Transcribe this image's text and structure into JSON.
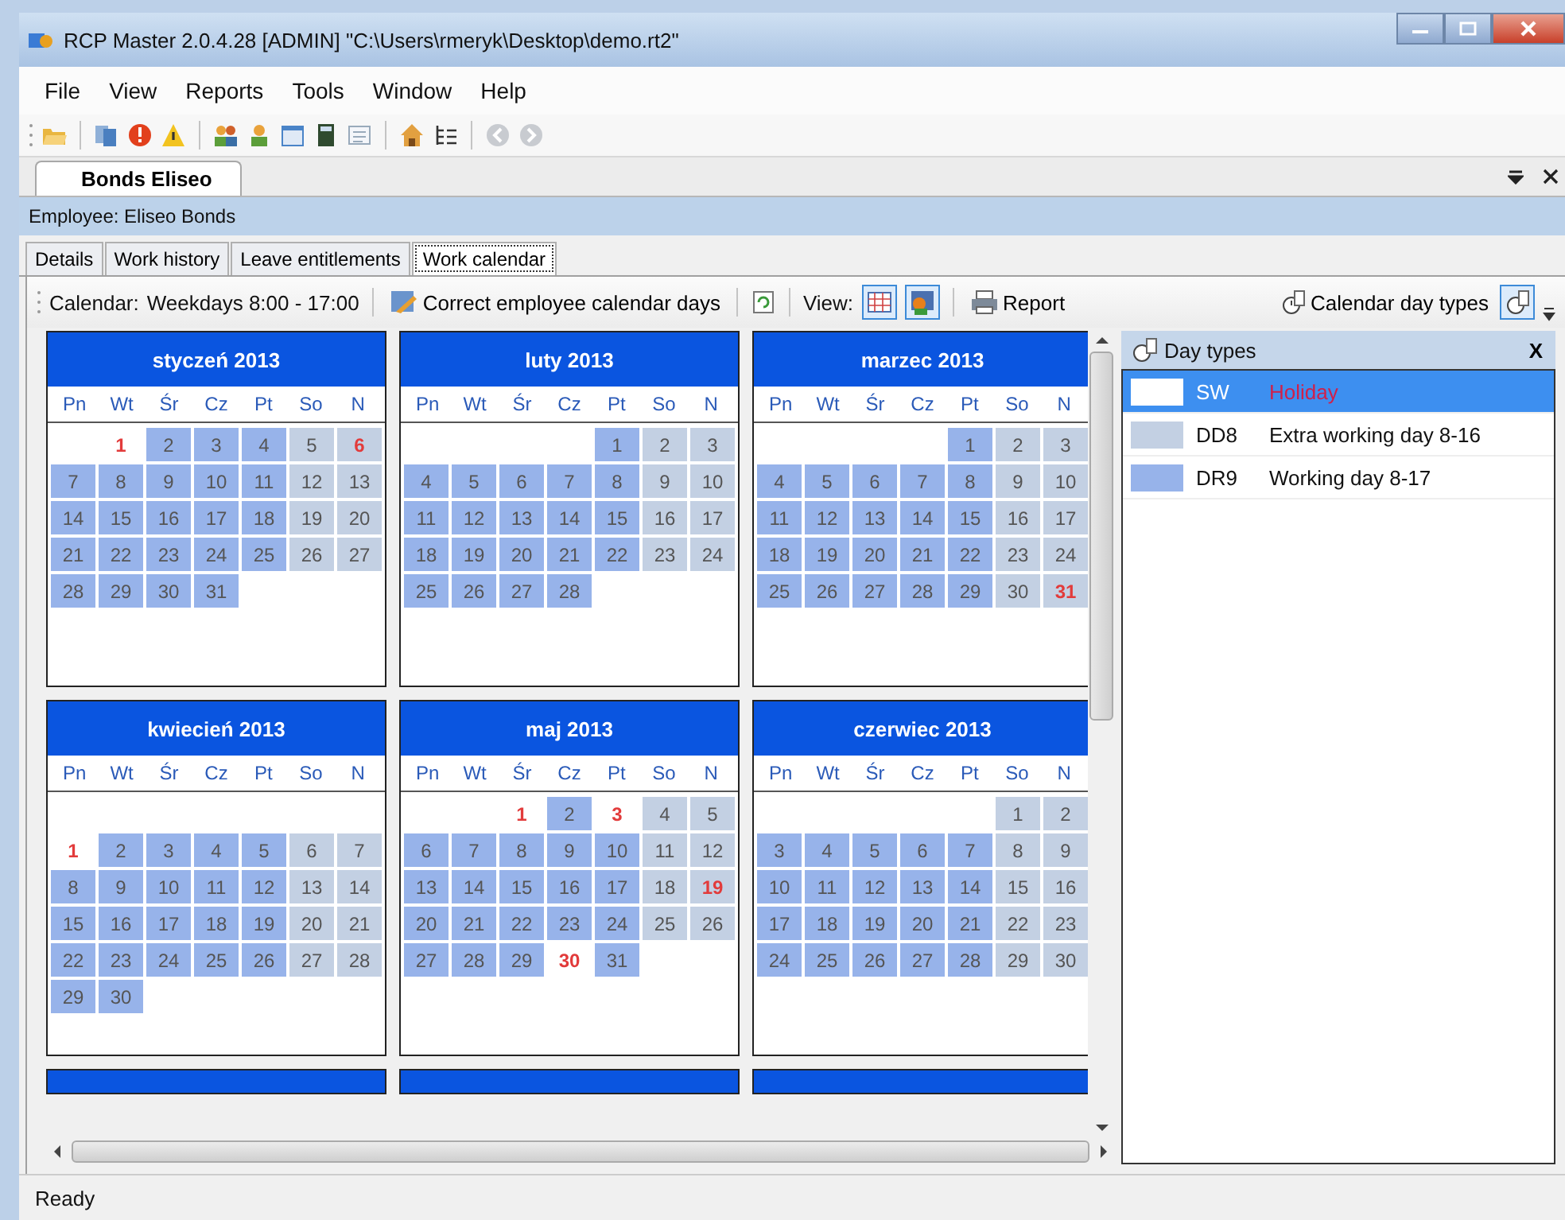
{
  "window": {
    "title": "RCP Master 2.0.4.28  [ADMIN] \"C:\\Users\\rmeryk\\Desktop\\demo.rt2\""
  },
  "menu": [
    "File",
    "View",
    "Reports",
    "Tools",
    "Window",
    "Help"
  ],
  "document_tabs": [
    {
      "label": "Bonds Eliseo",
      "selected": true
    }
  ],
  "employee_bar": "Employee: Eliseo Bonds",
  "tabs": [
    {
      "label": "Details",
      "selected": false
    },
    {
      "label": "Work history",
      "selected": false
    },
    {
      "label": "Leave entitlements",
      "selected": false
    },
    {
      "label": "Work calendar",
      "selected": true
    }
  ],
  "calendar_toolbar": {
    "calendar_label": "Calendar:",
    "calendar_value": "Weekdays 8:00 - 17:00",
    "correct_button": "Correct employee calendar days",
    "view_label": "View:",
    "report_button": "Report",
    "day_types_button": "Calendar day types"
  },
  "months": [
    {
      "title": "styczeń 2013",
      "weekdays": [
        "Pn",
        "Wt",
        "Śr",
        "Cz",
        "Pt",
        "So",
        "N"
      ],
      "weeks": [
        [
          {
            "kind": "blank"
          },
          {
            "kind": "day",
            "d": "1",
            "color": "#ffffff",
            "holiday": true
          },
          {
            "kind": "day",
            "d": "2",
            "color": "#97b3ea",
            "holiday": false
          },
          {
            "kind": "day",
            "d": "3",
            "color": "#97b3ea",
            "holiday": false
          },
          {
            "kind": "day",
            "d": "4",
            "color": "#97b3ea",
            "holiday": false
          },
          {
            "kind": "day",
            "d": "5",
            "color": "#c3d0e3",
            "holiday": false
          },
          {
            "kind": "day",
            "d": "6",
            "color": "#c3d0e3",
            "holiday": true
          }
        ],
        [
          {
            "kind": "day",
            "d": "7",
            "color": "#97b3ea",
            "holiday": false
          },
          {
            "kind": "day",
            "d": "8",
            "color": "#97b3ea",
            "holiday": false
          },
          {
            "kind": "day",
            "d": "9",
            "color": "#97b3ea",
            "holiday": false
          },
          {
            "kind": "day",
            "d": "10",
            "color": "#97b3ea",
            "holiday": false
          },
          {
            "kind": "day",
            "d": "11",
            "color": "#97b3ea",
            "holiday": false
          },
          {
            "kind": "day",
            "d": "12",
            "color": "#c3d0e3",
            "holiday": false
          },
          {
            "kind": "day",
            "d": "13",
            "color": "#c3d0e3",
            "holiday": false
          }
        ],
        [
          {
            "kind": "day",
            "d": "14",
            "color": "#97b3ea",
            "holiday": false
          },
          {
            "kind": "day",
            "d": "15",
            "color": "#97b3ea",
            "holiday": false
          },
          {
            "kind": "day",
            "d": "16",
            "color": "#97b3ea",
            "holiday": false
          },
          {
            "kind": "day",
            "d": "17",
            "color": "#97b3ea",
            "holiday": false
          },
          {
            "kind": "day",
            "d": "18",
            "color": "#97b3ea",
            "holiday": false
          },
          {
            "kind": "day",
            "d": "19",
            "color": "#c3d0e3",
            "holiday": false
          },
          {
            "kind": "day",
            "d": "20",
            "color": "#c3d0e3",
            "holiday": false
          }
        ],
        [
          {
            "kind": "day",
            "d": "21",
            "color": "#97b3ea",
            "holiday": false
          },
          {
            "kind": "day",
            "d": "22",
            "color": "#97b3ea",
            "holiday": false
          },
          {
            "kind": "day",
            "d": "23",
            "color": "#97b3ea",
            "holiday": false
          },
          {
            "kind": "day",
            "d": "24",
            "color": "#97b3ea",
            "holiday": false
          },
          {
            "kind": "day",
            "d": "25",
            "color": "#97b3ea",
            "holiday": false
          },
          {
            "kind": "day",
            "d": "26",
            "color": "#c3d0e3",
            "holiday": false
          },
          {
            "kind": "day",
            "d": "27",
            "color": "#c3d0e3",
            "holiday": false
          }
        ],
        [
          {
            "kind": "day",
            "d": "28",
            "color": "#97b3ea",
            "holiday": false
          },
          {
            "kind": "day",
            "d": "29",
            "color": "#97b3ea",
            "holiday": false
          },
          {
            "kind": "day",
            "d": "30",
            "color": "#97b3ea",
            "holiday": false
          },
          {
            "kind": "day",
            "d": "31",
            "color": "#97b3ea",
            "holiday": false
          },
          {
            "kind": "blank"
          },
          {
            "kind": "blank"
          },
          {
            "kind": "blank"
          }
        ]
      ]
    },
    {
      "title": "luty 2013",
      "weekdays": [
        "Pn",
        "Wt",
        "Śr",
        "Cz",
        "Pt",
        "So",
        "N"
      ],
      "weeks": [
        [
          {
            "kind": "blank"
          },
          {
            "kind": "blank"
          },
          {
            "kind": "blank"
          },
          {
            "kind": "blank"
          },
          {
            "kind": "day",
            "d": "1",
            "color": "#97b3ea",
            "holiday": false
          },
          {
            "kind": "day",
            "d": "2",
            "color": "#c3d0e3",
            "holiday": false
          },
          {
            "kind": "day",
            "d": "3",
            "color": "#c3d0e3",
            "holiday": false
          }
        ],
        [
          {
            "kind": "day",
            "d": "4",
            "color": "#97b3ea",
            "holiday": false
          },
          {
            "kind": "day",
            "d": "5",
            "color": "#97b3ea",
            "holiday": false
          },
          {
            "kind": "day",
            "d": "6",
            "color": "#97b3ea",
            "holiday": false
          },
          {
            "kind": "day",
            "d": "7",
            "color": "#97b3ea",
            "holiday": false
          },
          {
            "kind": "day",
            "d": "8",
            "color": "#97b3ea",
            "holiday": false
          },
          {
            "kind": "day",
            "d": "9",
            "color": "#c3d0e3",
            "holiday": false
          },
          {
            "kind": "day",
            "d": "10",
            "color": "#c3d0e3",
            "holiday": false
          }
        ],
        [
          {
            "kind": "day",
            "d": "11",
            "color": "#97b3ea",
            "holiday": false
          },
          {
            "kind": "day",
            "d": "12",
            "color": "#97b3ea",
            "holiday": false
          },
          {
            "kind": "day",
            "d": "13",
            "color": "#97b3ea",
            "holiday": false
          },
          {
            "kind": "day",
            "d": "14",
            "color": "#97b3ea",
            "holiday": false
          },
          {
            "kind": "day",
            "d": "15",
            "color": "#97b3ea",
            "holiday": false
          },
          {
            "kind": "day",
            "d": "16",
            "color": "#c3d0e3",
            "holiday": false
          },
          {
            "kind": "day",
            "d": "17",
            "color": "#c3d0e3",
            "holiday": false
          }
        ],
        [
          {
            "kind": "day",
            "d": "18",
            "color": "#97b3ea",
            "holiday": false
          },
          {
            "kind": "day",
            "d": "19",
            "color": "#97b3ea",
            "holiday": false
          },
          {
            "kind": "day",
            "d": "20",
            "color": "#97b3ea",
            "holiday": false
          },
          {
            "kind": "day",
            "d": "21",
            "color": "#97b3ea",
            "holiday": false
          },
          {
            "kind": "day",
            "d": "22",
            "color": "#97b3ea",
            "holiday": false
          },
          {
            "kind": "day",
            "d": "23",
            "color": "#c3d0e3",
            "holiday": false
          },
          {
            "kind": "day",
            "d": "24",
            "color": "#c3d0e3",
            "holiday": false
          }
        ],
        [
          {
            "kind": "day",
            "d": "25",
            "color": "#97b3ea",
            "holiday": false
          },
          {
            "kind": "day",
            "d": "26",
            "color": "#97b3ea",
            "holiday": false
          },
          {
            "kind": "day",
            "d": "27",
            "color": "#97b3ea",
            "holiday": false
          },
          {
            "kind": "day",
            "d": "28",
            "color": "#97b3ea",
            "holiday": false
          },
          {
            "kind": "blank"
          },
          {
            "kind": "blank"
          },
          {
            "kind": "blank"
          }
        ]
      ]
    },
    {
      "title": "marzec 2013",
      "weekdays": [
        "Pn",
        "Wt",
        "Śr",
        "Cz",
        "Pt",
        "So",
        "N"
      ],
      "weeks": [
        [
          {
            "kind": "blank"
          },
          {
            "kind": "blank"
          },
          {
            "kind": "blank"
          },
          {
            "kind": "blank"
          },
          {
            "kind": "day",
            "d": "1",
            "color": "#97b3ea",
            "holiday": false
          },
          {
            "kind": "day",
            "d": "2",
            "color": "#c3d0e3",
            "holiday": false
          },
          {
            "kind": "day",
            "d": "3",
            "color": "#c3d0e3",
            "holiday": false
          }
        ],
        [
          {
            "kind": "day",
            "d": "4",
            "color": "#97b3ea",
            "holiday": false
          },
          {
            "kind": "day",
            "d": "5",
            "color": "#97b3ea",
            "holiday": false
          },
          {
            "kind": "day",
            "d": "6",
            "color": "#97b3ea",
            "holiday": false
          },
          {
            "kind": "day",
            "d": "7",
            "color": "#97b3ea",
            "holiday": false
          },
          {
            "kind": "day",
            "d": "8",
            "color": "#97b3ea",
            "holiday": false
          },
          {
            "kind": "day",
            "d": "9",
            "color": "#c3d0e3",
            "holiday": false
          },
          {
            "kind": "day",
            "d": "10",
            "color": "#c3d0e3",
            "holiday": false
          }
        ],
        [
          {
            "kind": "day",
            "d": "11",
            "color": "#97b3ea",
            "holiday": false
          },
          {
            "kind": "day",
            "d": "12",
            "color": "#97b3ea",
            "holiday": false
          },
          {
            "kind": "day",
            "d": "13",
            "color": "#97b3ea",
            "holiday": false
          },
          {
            "kind": "day",
            "d": "14",
            "color": "#97b3ea",
            "holiday": false
          },
          {
            "kind": "day",
            "d": "15",
            "color": "#97b3ea",
            "holiday": false
          },
          {
            "kind": "day",
            "d": "16",
            "color": "#c3d0e3",
            "holiday": false
          },
          {
            "kind": "day",
            "d": "17",
            "color": "#c3d0e3",
            "holiday": false
          }
        ],
        [
          {
            "kind": "day",
            "d": "18",
            "color": "#97b3ea",
            "holiday": false
          },
          {
            "kind": "day",
            "d": "19",
            "color": "#97b3ea",
            "holiday": false
          },
          {
            "kind": "day",
            "d": "20",
            "color": "#97b3ea",
            "holiday": false
          },
          {
            "kind": "day",
            "d": "21",
            "color": "#97b3ea",
            "holiday": false
          },
          {
            "kind": "day",
            "d": "22",
            "color": "#97b3ea",
            "holiday": false
          },
          {
            "kind": "day",
            "d": "23",
            "color": "#c3d0e3",
            "holiday": false
          },
          {
            "kind": "day",
            "d": "24",
            "color": "#c3d0e3",
            "holiday": false
          }
        ],
        [
          {
            "kind": "day",
            "d": "25",
            "color": "#97b3ea",
            "holiday": false
          },
          {
            "kind": "day",
            "d": "26",
            "color": "#97b3ea",
            "holiday": false
          },
          {
            "kind": "day",
            "d": "27",
            "color": "#97b3ea",
            "holiday": false
          },
          {
            "kind": "day",
            "d": "28",
            "color": "#97b3ea",
            "holiday": false
          },
          {
            "kind": "day",
            "d": "29",
            "color": "#97b3ea",
            "holiday": false
          },
          {
            "kind": "day",
            "d": "30",
            "color": "#c3d0e3",
            "holiday": false
          },
          {
            "kind": "day",
            "d": "31",
            "color": "#c3d0e3",
            "holiday": true
          }
        ]
      ]
    },
    {
      "title": "kwiecień 2013",
      "weekdays": [
        "Pn",
        "Wt",
        "Śr",
        "Cz",
        "Pt",
        "So",
        "N"
      ],
      "weeks": [
        [
          {
            "kind": "blank"
          },
          {
            "kind": "blank"
          },
          {
            "kind": "blank"
          },
          {
            "kind": "blank"
          },
          {
            "kind": "blank"
          },
          {
            "kind": "blank"
          },
          {
            "kind": "blank"
          }
        ],
        [
          {
            "kind": "day",
            "d": "1",
            "color": "#ffffff",
            "holiday": true
          },
          {
            "kind": "day",
            "d": "2",
            "color": "#97b3ea",
            "holiday": false
          },
          {
            "kind": "day",
            "d": "3",
            "color": "#97b3ea",
            "holiday": false
          },
          {
            "kind": "day",
            "d": "4",
            "color": "#97b3ea",
            "holiday": false
          },
          {
            "kind": "day",
            "d": "5",
            "color": "#97b3ea",
            "holiday": false
          },
          {
            "kind": "day",
            "d": "6",
            "color": "#c3d0e3",
            "holiday": false
          },
          {
            "kind": "day",
            "d": "7",
            "color": "#c3d0e3",
            "holiday": false
          }
        ],
        [
          {
            "kind": "day",
            "d": "8",
            "color": "#97b3ea",
            "holiday": false
          },
          {
            "kind": "day",
            "d": "9",
            "color": "#97b3ea",
            "holiday": false
          },
          {
            "kind": "day",
            "d": "10",
            "color": "#97b3ea",
            "holiday": false
          },
          {
            "kind": "day",
            "d": "11",
            "color": "#97b3ea",
            "holiday": false
          },
          {
            "kind": "day",
            "d": "12",
            "color": "#97b3ea",
            "holiday": false
          },
          {
            "kind": "day",
            "d": "13",
            "color": "#c3d0e3",
            "holiday": false
          },
          {
            "kind": "day",
            "d": "14",
            "color": "#c3d0e3",
            "holiday": false
          }
        ],
        [
          {
            "kind": "day",
            "d": "15",
            "color": "#97b3ea",
            "holiday": false
          },
          {
            "kind": "day",
            "d": "16",
            "color": "#97b3ea",
            "holiday": false
          },
          {
            "kind": "day",
            "d": "17",
            "color": "#97b3ea",
            "holiday": false
          },
          {
            "kind": "day",
            "d": "18",
            "color": "#97b3ea",
            "holiday": false
          },
          {
            "kind": "day",
            "d": "19",
            "color": "#97b3ea",
            "holiday": false
          },
          {
            "kind": "day",
            "d": "20",
            "color": "#c3d0e3",
            "holiday": false
          },
          {
            "kind": "day",
            "d": "21",
            "color": "#c3d0e3",
            "holiday": false
          }
        ],
        [
          {
            "kind": "day",
            "d": "22",
            "color": "#97b3ea",
            "holiday": false
          },
          {
            "kind": "day",
            "d": "23",
            "color": "#97b3ea",
            "holiday": false
          },
          {
            "kind": "day",
            "d": "24",
            "color": "#97b3ea",
            "holiday": false
          },
          {
            "kind": "day",
            "d": "25",
            "color": "#97b3ea",
            "holiday": false
          },
          {
            "kind": "day",
            "d": "26",
            "color": "#97b3ea",
            "holiday": false
          },
          {
            "kind": "day",
            "d": "27",
            "color": "#c3d0e3",
            "holiday": false
          },
          {
            "kind": "day",
            "d": "28",
            "color": "#c3d0e3",
            "holiday": false
          }
        ],
        [
          {
            "kind": "day",
            "d": "29",
            "color": "#97b3ea",
            "holiday": false
          },
          {
            "kind": "day",
            "d": "30",
            "color": "#97b3ea",
            "holiday": false
          },
          {
            "kind": "blank"
          },
          {
            "kind": "blank"
          },
          {
            "kind": "blank"
          },
          {
            "kind": "blank"
          },
          {
            "kind": "blank"
          }
        ]
      ]
    },
    {
      "title": "maj 2013",
      "weekdays": [
        "Pn",
        "Wt",
        "Śr",
        "Cz",
        "Pt",
        "So",
        "N"
      ],
      "weeks": [
        [
          {
            "kind": "blank"
          },
          {
            "kind": "blank"
          },
          {
            "kind": "day",
            "d": "1",
            "color": "#ffffff",
            "holiday": true
          },
          {
            "kind": "day",
            "d": "2",
            "color": "#97b3ea",
            "holiday": false
          },
          {
            "kind": "day",
            "d": "3",
            "color": "#ffffff",
            "holiday": true
          },
          {
            "kind": "day",
            "d": "4",
            "color": "#c3d0e3",
            "holiday": false
          },
          {
            "kind": "day",
            "d": "5",
            "color": "#c3d0e3",
            "holiday": false
          }
        ],
        [
          {
            "kind": "day",
            "d": "6",
            "color": "#97b3ea",
            "holiday": false
          },
          {
            "kind": "day",
            "d": "7",
            "color": "#97b3ea",
            "holiday": false
          },
          {
            "kind": "day",
            "d": "8",
            "color": "#97b3ea",
            "holiday": false
          },
          {
            "kind": "day",
            "d": "9",
            "color": "#97b3ea",
            "holiday": false
          },
          {
            "kind": "day",
            "d": "10",
            "color": "#97b3ea",
            "holiday": false
          },
          {
            "kind": "day",
            "d": "11",
            "color": "#c3d0e3",
            "holiday": false
          },
          {
            "kind": "day",
            "d": "12",
            "color": "#c3d0e3",
            "holiday": false
          }
        ],
        [
          {
            "kind": "day",
            "d": "13",
            "color": "#97b3ea",
            "holiday": false
          },
          {
            "kind": "day",
            "d": "14",
            "color": "#97b3ea",
            "holiday": false
          },
          {
            "kind": "day",
            "d": "15",
            "color": "#97b3ea",
            "holiday": false
          },
          {
            "kind": "day",
            "d": "16",
            "color": "#97b3ea",
            "holiday": false
          },
          {
            "kind": "day",
            "d": "17",
            "color": "#97b3ea",
            "holiday": false
          },
          {
            "kind": "day",
            "d": "18",
            "color": "#c3d0e3",
            "holiday": false
          },
          {
            "kind": "day",
            "d": "19",
            "color": "#c3d0e3",
            "holiday": true
          }
        ],
        [
          {
            "kind": "day",
            "d": "20",
            "color": "#97b3ea",
            "holiday": false
          },
          {
            "kind": "day",
            "d": "21",
            "color": "#97b3ea",
            "holiday": false
          },
          {
            "kind": "day",
            "d": "22",
            "color": "#97b3ea",
            "holiday": false
          },
          {
            "kind": "day",
            "d": "23",
            "color": "#97b3ea",
            "holiday": false
          },
          {
            "kind": "day",
            "d": "24",
            "color": "#97b3ea",
            "holiday": false
          },
          {
            "kind": "day",
            "d": "25",
            "color": "#c3d0e3",
            "holiday": false
          },
          {
            "kind": "day",
            "d": "26",
            "color": "#c3d0e3",
            "holiday": false
          }
        ],
        [
          {
            "kind": "day",
            "d": "27",
            "color": "#97b3ea",
            "holiday": false
          },
          {
            "kind": "day",
            "d": "28",
            "color": "#97b3ea",
            "holiday": false
          },
          {
            "kind": "day",
            "d": "29",
            "color": "#97b3ea",
            "holiday": false
          },
          {
            "kind": "day",
            "d": "30",
            "color": "#ffffff",
            "holiday": true
          },
          {
            "kind": "day",
            "d": "31",
            "color": "#97b3ea",
            "holiday": false
          },
          {
            "kind": "blank"
          },
          {
            "kind": "blank"
          }
        ]
      ]
    },
    {
      "title": "czerwiec 2013",
      "weekdays": [
        "Pn",
        "Wt",
        "Śr",
        "Cz",
        "Pt",
        "So",
        "N"
      ],
      "weeks": [
        [
          {
            "kind": "blank"
          },
          {
            "kind": "blank"
          },
          {
            "kind": "blank"
          },
          {
            "kind": "blank"
          },
          {
            "kind": "blank"
          },
          {
            "kind": "day",
            "d": "1",
            "color": "#c3d0e3",
            "holiday": false
          },
          {
            "kind": "day",
            "d": "2",
            "color": "#c3d0e3",
            "holiday": false
          }
        ],
        [
          {
            "kind": "day",
            "d": "3",
            "color": "#97b3ea",
            "holiday": false
          },
          {
            "kind": "day",
            "d": "4",
            "color": "#97b3ea",
            "holiday": false
          },
          {
            "kind": "day",
            "d": "5",
            "color": "#97b3ea",
            "holiday": false
          },
          {
            "kind": "day",
            "d": "6",
            "color": "#97b3ea",
            "holiday": false
          },
          {
            "kind": "day",
            "d": "7",
            "color": "#97b3ea",
            "holiday": false
          },
          {
            "kind": "day",
            "d": "8",
            "color": "#c3d0e3",
            "holiday": false
          },
          {
            "kind": "day",
            "d": "9",
            "color": "#c3d0e3",
            "holiday": false
          }
        ],
        [
          {
            "kind": "day",
            "d": "10",
            "color": "#97b3ea",
            "holiday": false
          },
          {
            "kind": "day",
            "d": "11",
            "color": "#97b3ea",
            "holiday": false
          },
          {
            "kind": "day",
            "d": "12",
            "color": "#97b3ea",
            "holiday": false
          },
          {
            "kind": "day",
            "d": "13",
            "color": "#97b3ea",
            "holiday": false
          },
          {
            "kind": "day",
            "d": "14",
            "color": "#97b3ea",
            "holiday": false
          },
          {
            "kind": "day",
            "d": "15",
            "color": "#c3d0e3",
            "holiday": false
          },
          {
            "kind": "day",
            "d": "16",
            "color": "#c3d0e3",
            "holiday": false
          }
        ],
        [
          {
            "kind": "day",
            "d": "17",
            "color": "#97b3ea",
            "holiday": false
          },
          {
            "kind": "day",
            "d": "18",
            "color": "#97b3ea",
            "holiday": false
          },
          {
            "kind": "day",
            "d": "19",
            "color": "#97b3ea",
            "holiday": false
          },
          {
            "kind": "day",
            "d": "20",
            "color": "#97b3ea",
            "holiday": false
          },
          {
            "kind": "day",
            "d": "21",
            "color": "#97b3ea",
            "holiday": false
          },
          {
            "kind": "day",
            "d": "22",
            "color": "#c3d0e3",
            "holiday": false
          },
          {
            "kind": "day",
            "d": "23",
            "color": "#c3d0e3",
            "holiday": false
          }
        ],
        [
          {
            "kind": "day",
            "d": "24",
            "color": "#97b3ea",
            "holiday": false
          },
          {
            "kind": "day",
            "d": "25",
            "color": "#97b3ea",
            "holiday": false
          },
          {
            "kind": "day",
            "d": "26",
            "color": "#97b3ea",
            "holiday": false
          },
          {
            "kind": "day",
            "d": "27",
            "color": "#97b3ea",
            "holiday": false
          },
          {
            "kind": "day",
            "d": "28",
            "color": "#97b3ea",
            "holiday": false
          },
          {
            "kind": "day",
            "d": "29",
            "color": "#c3d0e3",
            "holiday": false
          },
          {
            "kind": "day",
            "d": "30",
            "color": "#c3d0e3",
            "holiday": false
          }
        ]
      ]
    }
  ],
  "day_types_panel": {
    "title": "Day types",
    "close": "X",
    "items": [
      {
        "code": "SW",
        "name": "Holiday",
        "color": "#ffffff",
        "selected": true
      },
      {
        "code": "DD8",
        "name": "Extra working day 8-16",
        "color": "#c3d0e3",
        "selected": false
      },
      {
        "code": "DR9",
        "name": "Working day 8-17",
        "color": "#97b3ea",
        "selected": false
      }
    ]
  },
  "status_bar": "Ready"
}
